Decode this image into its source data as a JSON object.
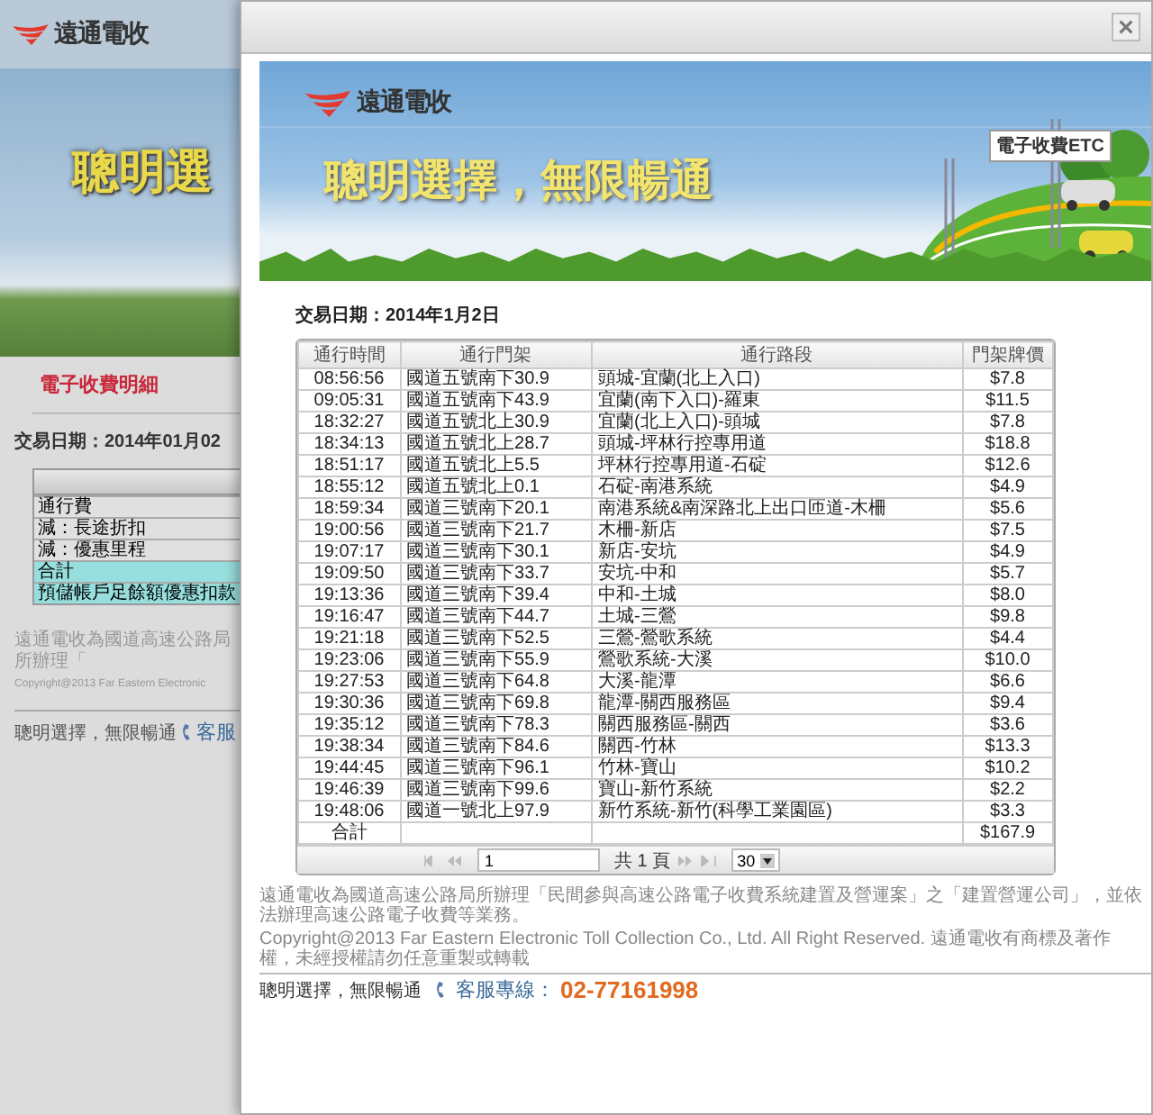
{
  "background_page": {
    "logo_text": "遠通電收",
    "slogan": "聰明選",
    "heading": "電子收費明細",
    "date_label": "交易日期：2014年01月02",
    "table": {
      "rows": [
        {
          "label": "通行費",
          "highlighted": false
        },
        {
          "label": "減：長途折扣",
          "highlighted": false
        },
        {
          "label": "減：優惠里程",
          "highlighted": false
        },
        {
          "label": "合計",
          "highlighted": true
        },
        {
          "label": "預儲帳戶足餘額優惠扣款",
          "highlighted": true
        }
      ]
    },
    "footer_lines": [
      "遠通電收為國道高速公路局所辦理「",
      "Copyright@2013 Far Eastern Electronic"
    ],
    "footer_slogan": "聰明選擇，無限暢通",
    "service_label": "客服"
  },
  "dialog": {
    "banner": {
      "logo_text": "遠通電收",
      "slogan": "聰明選擇，無限暢通",
      "sign_text": "電子收費ETC"
    },
    "date_label": "交易日期：2014年1月2日",
    "table": {
      "columns": [
        "通行時間",
        "通行門架",
        "通行路段",
        "門架牌價"
      ],
      "rows": [
        {
          "time": "08:56:56",
          "gantry": "國道五號南下30.9",
          "section": "頭城-宜蘭(北上入口)",
          "price": "$7.8"
        },
        {
          "time": "09:05:31",
          "gantry": "國道五號南下43.9",
          "section": "宜蘭(南下入口)-羅東",
          "price": "$11.5"
        },
        {
          "time": "18:32:27",
          "gantry": "國道五號北上30.9",
          "section": "宜蘭(北上入口)-頭城",
          "price": "$7.8"
        },
        {
          "time": "18:34:13",
          "gantry": "國道五號北上28.7",
          "section": "頭城-坪林行控專用道",
          "price": "$18.8"
        },
        {
          "time": "18:51:17",
          "gantry": "國道五號北上5.5",
          "section": "坪林行控專用道-石碇",
          "price": "$12.6"
        },
        {
          "time": "18:55:12",
          "gantry": "國道五號北上0.1",
          "section": "石碇-南港系統",
          "price": "$4.9"
        },
        {
          "time": "18:59:34",
          "gantry": "國道三號南下20.1",
          "section": "南港系統&南深路北上出口匝道-木柵",
          "price": "$5.6"
        },
        {
          "time": "19:00:56",
          "gantry": "國道三號南下21.7",
          "section": "木柵-新店",
          "price": "$7.5"
        },
        {
          "time": "19:07:17",
          "gantry": "國道三號南下30.1",
          "section": "新店-安坑",
          "price": "$4.9"
        },
        {
          "time": "19:09:50",
          "gantry": "國道三號南下33.7",
          "section": "安坑-中和",
          "price": "$5.7"
        },
        {
          "time": "19:13:36",
          "gantry": "國道三號南下39.4",
          "section": "中和-土城",
          "price": "$8.0"
        },
        {
          "time": "19:16:47",
          "gantry": "國道三號南下44.7",
          "section": "土城-三鶯",
          "price": "$9.8"
        },
        {
          "time": "19:21:18",
          "gantry": "國道三號南下52.5",
          "section": "三鶯-鶯歌系統",
          "price": "$4.4"
        },
        {
          "time": "19:23:06",
          "gantry": "國道三號南下55.9",
          "section": "鶯歌系統-大溪",
          "price": "$10.0"
        },
        {
          "time": "19:27:53",
          "gantry": "國道三號南下64.8",
          "section": "大溪-龍潭",
          "price": "$6.6"
        },
        {
          "time": "19:30:36",
          "gantry": "國道三號南下69.8",
          "section": "龍潭-關西服務區",
          "price": "$9.4"
        },
        {
          "time": "19:35:12",
          "gantry": "國道三號南下78.3",
          "section": "關西服務區-關西",
          "price": "$3.6"
        },
        {
          "time": "19:38:34",
          "gantry": "國道三號南下84.6",
          "section": "關西-竹林",
          "price": "$13.3"
        },
        {
          "time": "19:44:45",
          "gantry": "國道三號南下96.1",
          "section": "竹林-寶山",
          "price": "$10.2"
        },
        {
          "time": "19:46:39",
          "gantry": "國道三號南下99.6",
          "section": "寶山-新竹系統",
          "price": "$2.2"
        },
        {
          "time": "19:48:06",
          "gantry": "國道一號北上97.9",
          "section": "新竹系統-新竹(科學工業園區)",
          "price": "$3.3"
        }
      ],
      "total": {
        "label": "合計",
        "price": "$167.9"
      }
    },
    "pager": {
      "page": "1",
      "total_pages": "共 1 頁",
      "page_size": "30",
      "nav_disabled": true
    },
    "footer": {
      "notice": "遠通電收為國道高速公路局所辦理「民間參與高速公路電子收費系統建置及營運案」之「建置營運公司」，並依法辦理高速公路電子收費等業務。",
      "copyright": "Copyright@2013 Far Eastern Electronic Toll Collection Co., Ltd. All Right Reserved. 遠通電收有商標及著作權，未經授權請勿任意重製或轉載",
      "slogan": "聰明選擇，無限暢通",
      "hotline_label": "客服專線：",
      "hotline_number": "02-77161998"
    }
  }
}
